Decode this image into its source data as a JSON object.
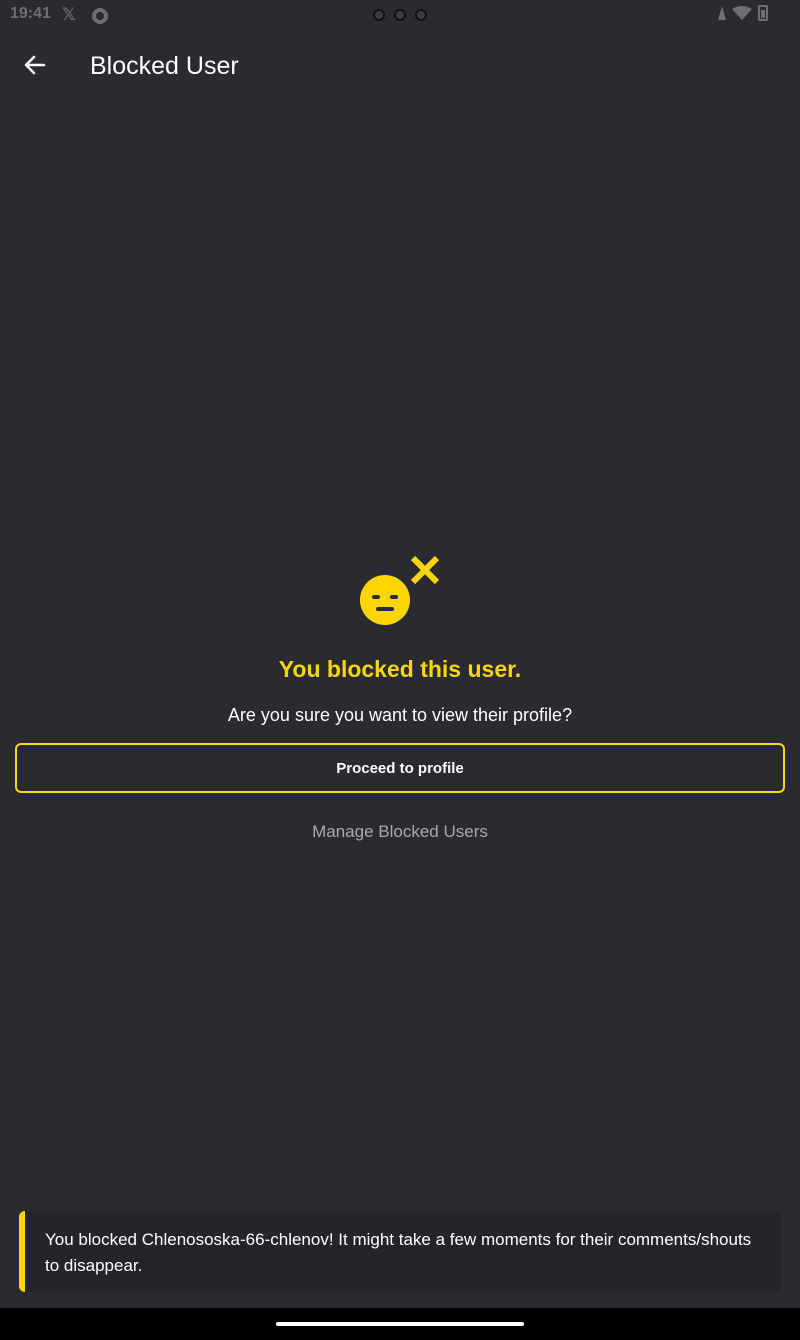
{
  "status_bar": {
    "time": "19:41",
    "x_icon_glyph": "𝕏",
    "icons": [
      "x-app-icon",
      "app-notification-icon",
      "signal-icon",
      "wifi-icon",
      "battery-icon"
    ]
  },
  "app_bar": {
    "title": "Blocked User",
    "back_icon": "arrow-left-icon"
  },
  "blocked": {
    "icon": "blocked-face-icon",
    "title": "You blocked this user.",
    "subtitle": "Are you sure you want to view their profile?",
    "proceed_label": "Proceed to profile",
    "manage_label": "Manage Blocked Users"
  },
  "snackbar": {
    "message": "You blocked Chlenososka-66-chlenov! It might take a few moments for their comments/shouts to disappear."
  },
  "colors": {
    "background": "#2a2b30",
    "accent": "#ffd500",
    "text_primary": "#ffffff",
    "text_secondary": "#a8a9ad",
    "snackbar_bg": "#24252a"
  }
}
